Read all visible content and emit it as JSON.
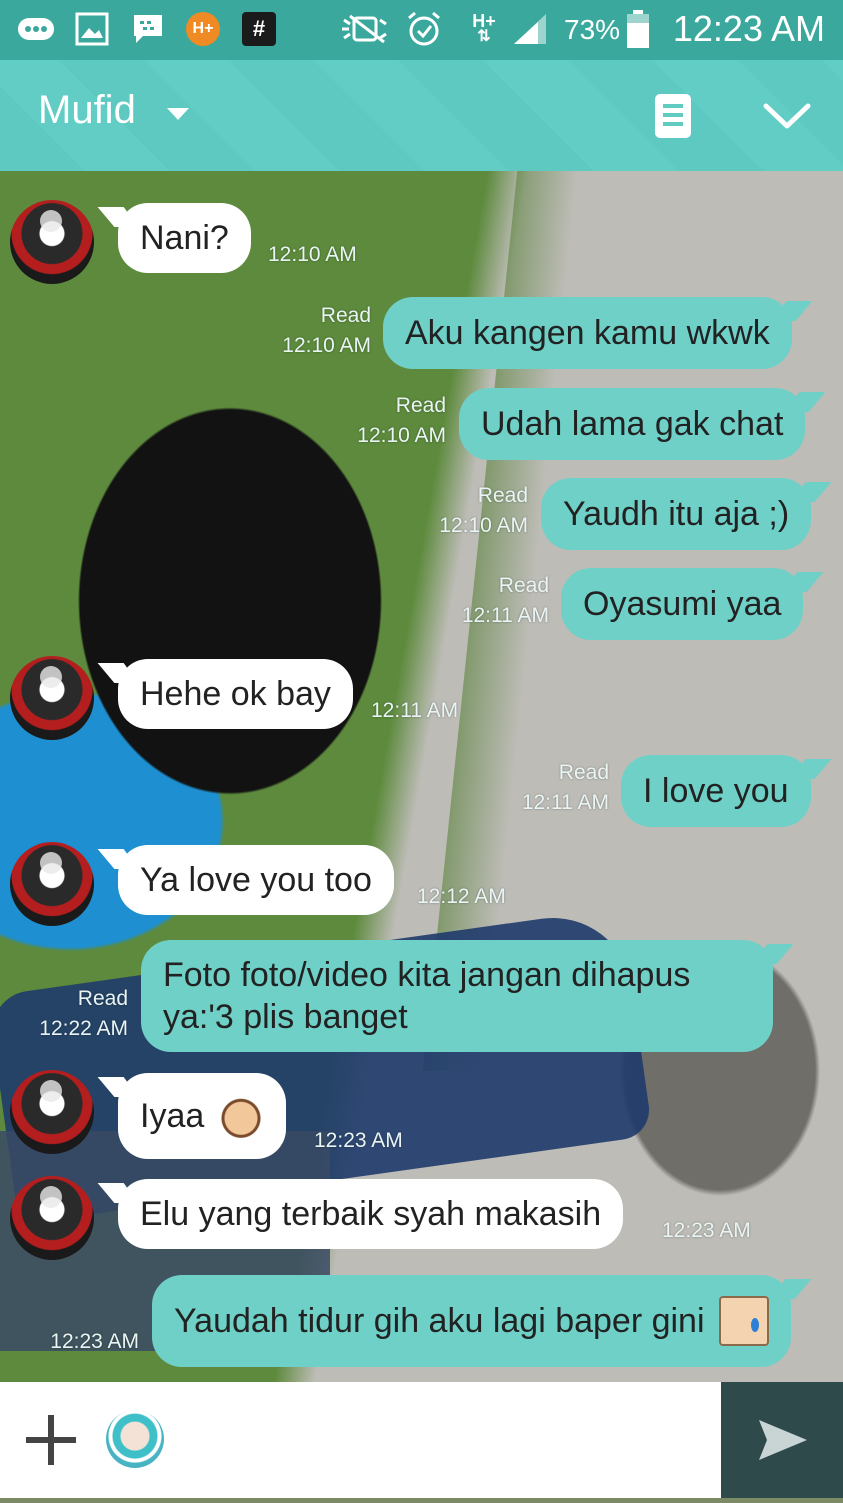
{
  "status_bar": {
    "icons": [
      "chat-notification-icon",
      "image-notification-icon",
      "messenger-icon",
      "hplus-icon",
      "hashtag-icon",
      "mute-icon",
      "alarm-icon",
      "network-hplus-icon",
      "signal-icon",
      "battery-icon"
    ],
    "hplus_label": "H+",
    "hash_label": "#",
    "network_label": "H+",
    "battery_percent": "73%",
    "time": "12:23 AM",
    "accent": "#3aa89c"
  },
  "header": {
    "title": "Mufid",
    "dropdown_icon": "caret-down-icon",
    "notes_icon": "notes-icon",
    "collapse_icon": "chevron-down-icon",
    "color": "#5fcbc1"
  },
  "messages": [
    {
      "side": "in",
      "text": "Nani?",
      "time": "12:10 AM"
    },
    {
      "side": "out",
      "text": "Aku kangen kamu wkwk",
      "read": "Read",
      "time": "12:10 AM"
    },
    {
      "side": "out",
      "text": "Udah lama gak chat",
      "read": "Read",
      "time": "12:10 AM"
    },
    {
      "side": "out",
      "text": "Yaudh itu aja ;)",
      "read": "Read",
      "time": "12:10 AM"
    },
    {
      "side": "out",
      "text": "Oyasumi yaa",
      "read": "Read",
      "time": "12:11 AM"
    },
    {
      "side": "in",
      "text": "Hehe ok bay",
      "time": "12:11 AM"
    },
    {
      "side": "out",
      "text": "I love you",
      "read": "Read",
      "time": "12:11 AM"
    },
    {
      "side": "in",
      "text": "Ya love you too",
      "time": "12:12 AM"
    },
    {
      "side": "out",
      "text": "Foto foto/video kita jangan dihapus ya:'3 plis banget",
      "read": "Read",
      "time": "12:22 AM"
    },
    {
      "side": "in",
      "text": "Iyaa",
      "time": "12:23 AM",
      "emoji": "laughing-face-icon"
    },
    {
      "side": "in",
      "text": "Elu yang terbaik syah makasih",
      "time": "12:23 AM"
    },
    {
      "side": "out",
      "text": "Yaudah tidur gih aku lagi baper gini",
      "time": "12:23 AM",
      "emoji": "crying-face-icon"
    }
  ],
  "input_bar": {
    "plus_icon": "plus-icon",
    "sticker_icon": "sticker-icon",
    "send_icon": "send-icon",
    "send_color": "#2e4a4b"
  },
  "colors": {
    "outgoing_bubble": "#6fd0c8",
    "incoming_bubble": "#ffffff"
  }
}
